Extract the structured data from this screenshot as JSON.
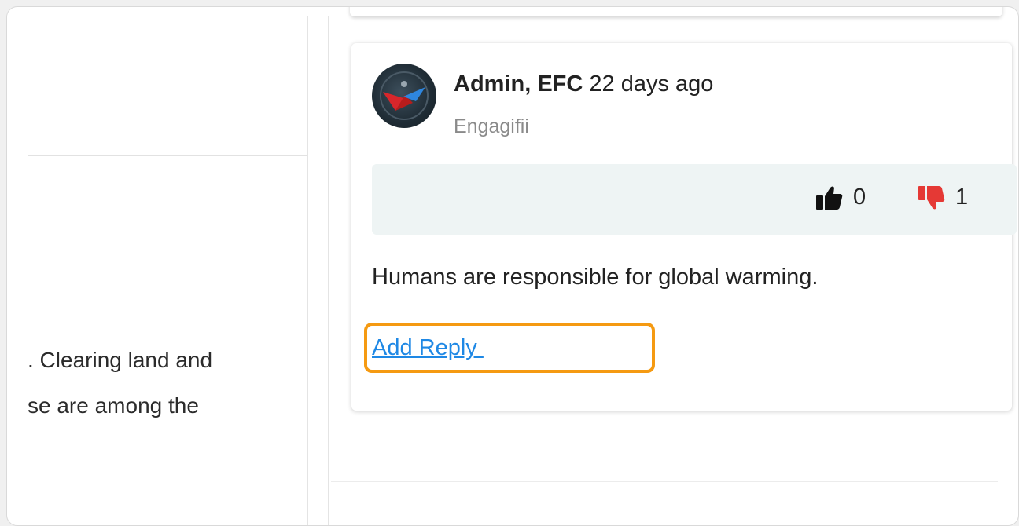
{
  "left_pane": {
    "text_line_1": ". Clearing land and",
    "text_line_2": "se are among the"
  },
  "comment": {
    "author": "Admin, EFC",
    "time_ago": "22 days ago",
    "organization": "Engagifii",
    "likes": "0",
    "dislikes": "1",
    "body": "Humans are responsible for global warming.",
    "reply_label": "Add Reply "
  },
  "colors": {
    "link": "#1e88e5",
    "highlight": "#f59a12",
    "dislike": "#e53935",
    "vote_bar_bg": "#eef4f4"
  },
  "icons": {
    "like": "thumbs-up-icon",
    "dislike": "thumbs-down-icon"
  }
}
